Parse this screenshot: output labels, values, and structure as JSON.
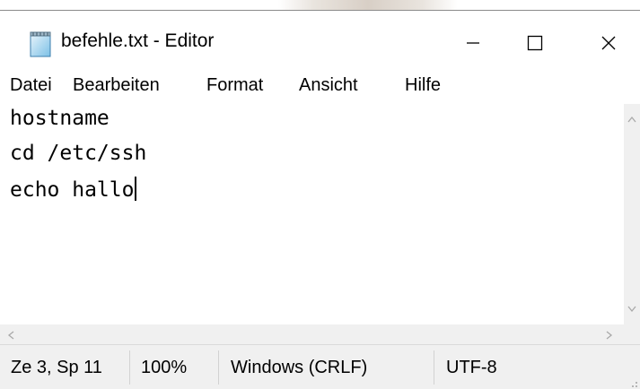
{
  "window": {
    "title": "befehle.txt - Editor",
    "icon": "notepad-icon",
    "controls": [
      "minimize-icon",
      "maximize-icon",
      "close-icon"
    ]
  },
  "menu": {
    "items": [
      {
        "label": "Datei"
      },
      {
        "label": "Bearbeiten"
      },
      {
        "label": "Format"
      },
      {
        "label": "Ansicht"
      },
      {
        "label": "Hilfe"
      }
    ]
  },
  "editor": {
    "lines": [
      "hostname",
      "cd /etc/ssh",
      "echo hallo"
    ],
    "caret_line": 3
  },
  "status": {
    "position": "Ze 3, Sp 11",
    "zoom": "100%",
    "line_ending": "Windows (CRLF)",
    "encoding": "UTF-8"
  },
  "colors": {
    "chrome": "#f0f0f0",
    "editor_bg": "#ffffff",
    "scroll_arrow": "#a9a9a9"
  }
}
